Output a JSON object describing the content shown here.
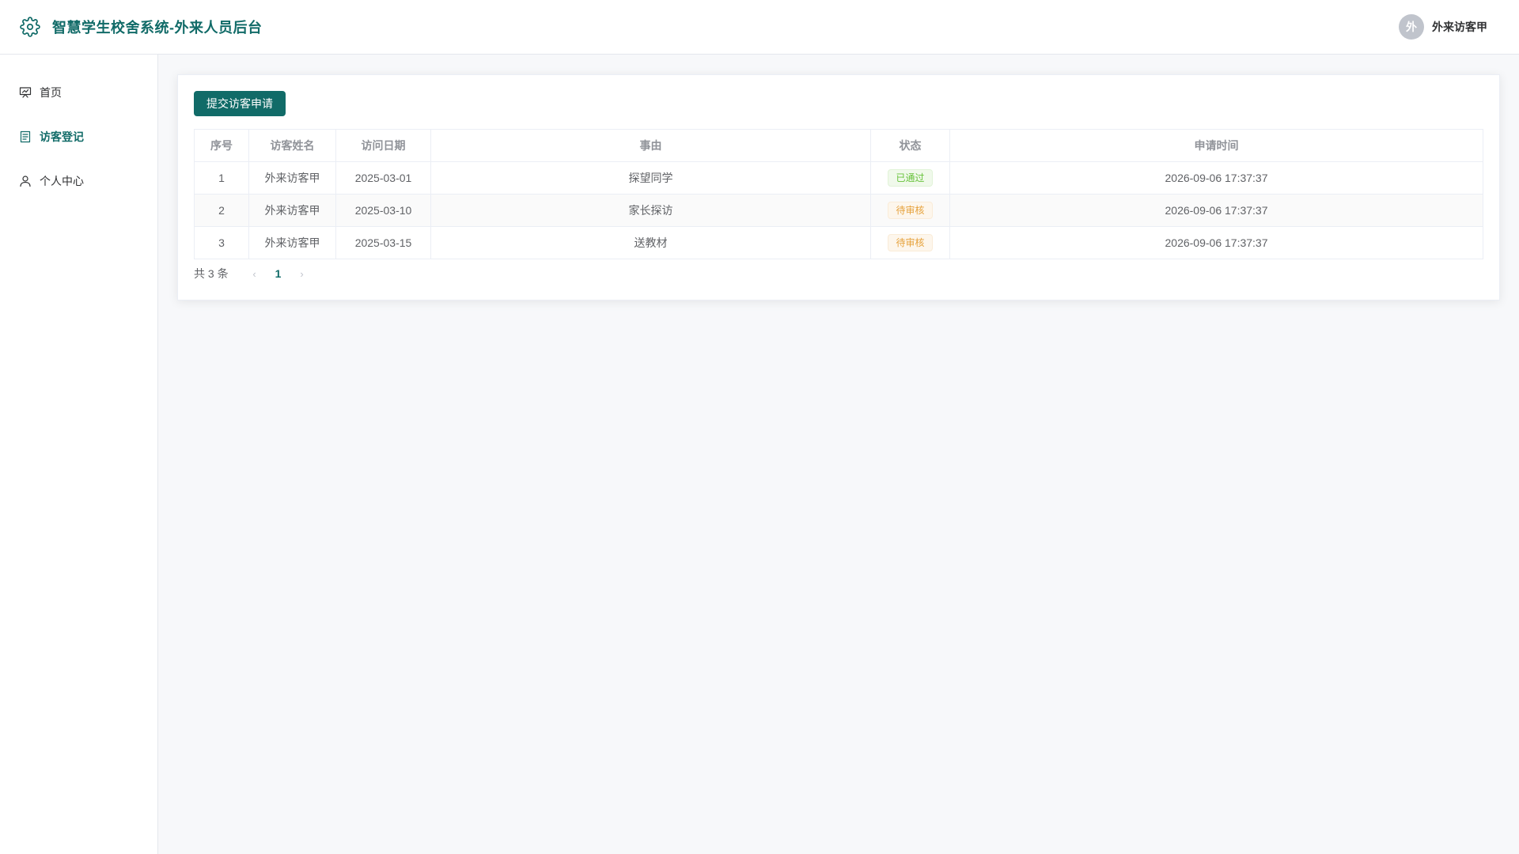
{
  "header": {
    "title": "智慧学生校舍系统-外来人员后台",
    "logo_icon": "gear-icon",
    "user": {
      "avatar_text": "外",
      "name": "外来访客甲"
    }
  },
  "colors": {
    "brand": "#116b68",
    "success": "#67c23a",
    "warning": "#e6a23c"
  },
  "sidebar": {
    "items": [
      {
        "label": "首页",
        "icon": "presentation-icon",
        "active": false
      },
      {
        "label": "访客登记",
        "icon": "document-icon",
        "active": true
      },
      {
        "label": "个人中心",
        "icon": "user-icon",
        "active": false
      }
    ]
  },
  "main": {
    "submit_button": "提交访客申请",
    "table": {
      "headers": [
        "序号",
        "访客姓名",
        "访问日期",
        "事由",
        "状态",
        "申请时间"
      ],
      "rows": [
        {
          "index": "1",
          "name": "外来访客甲",
          "date": "2025-03-01",
          "reason": "探望同学",
          "status": "已通过",
          "status_type": "success",
          "applied_at": "2026-09-06 17:37:37"
        },
        {
          "index": "2",
          "name": "外来访客甲",
          "date": "2025-03-10",
          "reason": "家长探访",
          "status": "待审核",
          "status_type": "warning",
          "applied_at": "2026-09-06 17:37:37"
        },
        {
          "index": "3",
          "name": "外来访客甲",
          "date": "2025-03-15",
          "reason": "送教材",
          "status": "待审核",
          "status_type": "warning",
          "applied_at": "2026-09-06 17:37:37"
        }
      ]
    },
    "pagination": {
      "total_text": "共 3 条",
      "current_page": "1",
      "prev_icon": "chevron-left-icon",
      "next_icon": "chevron-right-icon"
    }
  }
}
